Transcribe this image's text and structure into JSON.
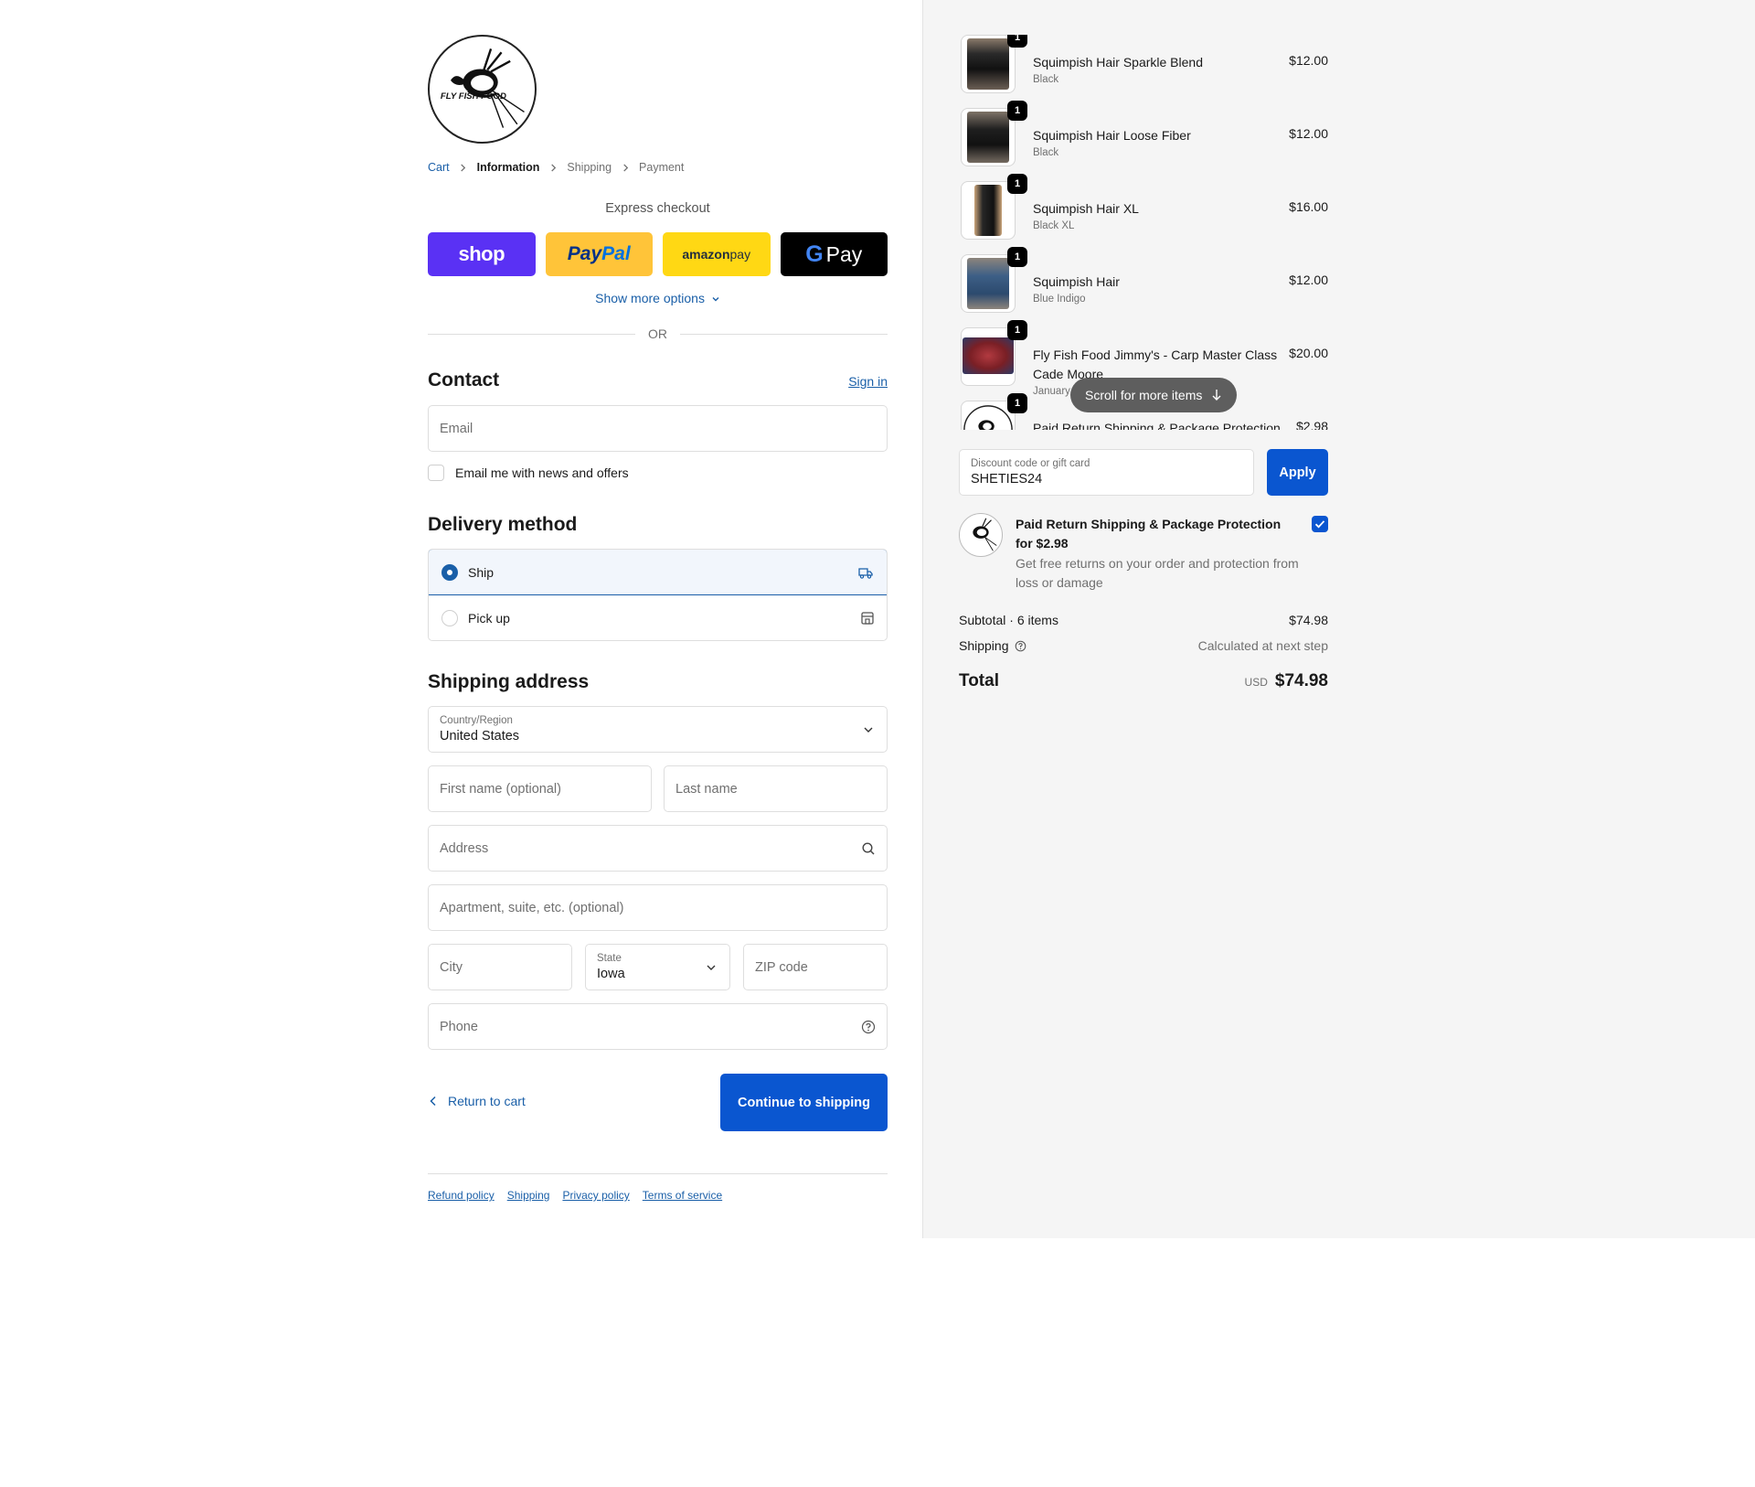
{
  "brand": {
    "logo_text": "FLY FISH FOOD"
  },
  "breadcrumb": [
    {
      "label": "Cart"
    },
    {
      "label": "Information"
    },
    {
      "label": "Shipping"
    },
    {
      "label": "Payment"
    }
  ],
  "express": {
    "title": "Express checkout",
    "buttons": {
      "shop": "shop",
      "paypal_a": "Pay",
      "paypal_b": "Pal",
      "amazon_a": "amazon",
      "amazon_b": " pay",
      "gpay_g": "G",
      "gpay_text": "Pay"
    },
    "show_more": "Show more options",
    "or": "OR"
  },
  "contact": {
    "title": "Contact",
    "signin": "Sign in",
    "email_placeholder": "Email",
    "newsletter_label": "Email me with news and offers",
    "newsletter_checked": false
  },
  "delivery": {
    "title": "Delivery method",
    "options": [
      {
        "label": "Ship",
        "selected": true,
        "icon": "truck-icon"
      },
      {
        "label": "Pick up",
        "selected": false,
        "icon": "store-icon"
      }
    ]
  },
  "shipping": {
    "title": "Shipping address",
    "country_label": "Country/Region",
    "country_value": "United States",
    "first_name_placeholder": "First name (optional)",
    "last_name_placeholder": "Last name",
    "address_placeholder": "Address",
    "apartment_placeholder": "Apartment, suite, etc. (optional)",
    "city_placeholder": "City",
    "state_label": "State",
    "state_value": "Iowa",
    "zip_placeholder": "ZIP code",
    "phone_placeholder": "Phone"
  },
  "actions": {
    "return_label": "Return to cart",
    "continue_label": "Continue to shipping"
  },
  "footer": {
    "links": [
      "Refund policy",
      "Shipping",
      "Privacy policy",
      "Terms of service"
    ]
  },
  "summary": {
    "items": [
      {
        "name": "Squimpish Hair Sparkle Blend",
        "variant": "Black",
        "price": "$12.00",
        "qty": "1",
        "thumb_color": "#2a2a2a"
      },
      {
        "name": "Squimpish Hair Loose Fiber",
        "variant": "Black",
        "price": "$12.00",
        "qty": "1",
        "thumb_color": "#1f1f1f"
      },
      {
        "name": "Squimpish Hair XL",
        "variant": "Black XL",
        "price": "$16.00",
        "qty": "1",
        "thumb_color": "#262626"
      },
      {
        "name": "Squimpish Hair",
        "variant": "Blue Indigo",
        "price": "$12.00",
        "qty": "1",
        "thumb_color": "#3d5f86"
      },
      {
        "name": "Fly Fish Food Jimmy's - Carp Master Class Cade Moore",
        "variant": "January",
        "price": "$20.00",
        "qty": "1",
        "thumb_color": "#7a1f25"
      },
      {
        "name": "Paid Return Shipping & Package Protection",
        "variant": "",
        "price": "$2.98",
        "qty": "1",
        "thumb_color": "#ffffff"
      }
    ],
    "scroll_hint": "Scroll for more items",
    "discount_label": "Discount code or gift card",
    "discount_value": "SHETIES24",
    "apply_label": "Apply",
    "protection": {
      "title": "Paid Return Shipping & Package Protection for $2.98",
      "description": "Get free returns on your order and protection from loss or damage",
      "checked": true
    },
    "subtotal_label": "Subtotal · 6 items",
    "subtotal_value": "$74.98",
    "shipping_label": "Shipping",
    "shipping_value": "Calculated at next step",
    "total_label": "Total",
    "total_currency": "USD",
    "total_value": "$74.98"
  },
  "colors": {
    "accent": "#0a56d0",
    "link": "#1a5fa8",
    "summary_bg": "#f5f5f5",
    "shop_pay": "#5a31f4",
    "paypal": "#ffc439",
    "amazon_pay": "#ffd814"
  }
}
